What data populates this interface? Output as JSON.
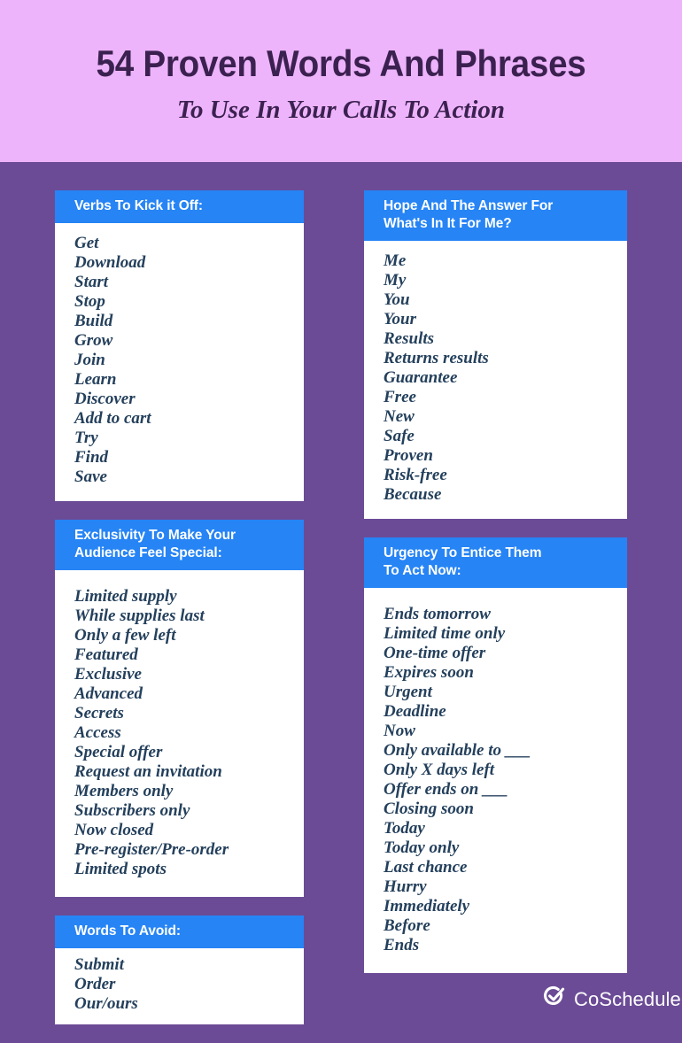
{
  "header": {
    "title": "54 Proven Words And Phrases",
    "subtitle": "To Use In Your Calls To Action",
    "background_color": "#eeb4fb",
    "text_color": "#3b2150"
  },
  "theme": {
    "page_background": "#6b4b96",
    "card_background": "#ffffff",
    "card_header_color": "#2684f5",
    "item_text_color": "#24405c"
  },
  "columns": {
    "left": [
      {
        "title_lines": [
          "Verbs To Kick it Off:"
        ],
        "items": [
          "Get",
          "Download",
          "Start",
          "Stop",
          "Build",
          "Grow",
          "Join",
          "Learn",
          "Discover",
          "Add to cart",
          "Try",
          "Find",
          "Save"
        ]
      },
      {
        "title_lines": [
          "Exclusivity To Make Your",
          "Audience Feel Special:"
        ],
        "items": [
          "Limited supply",
          "While supplies last",
          "Only a few left",
          "Featured",
          "Exclusive",
          "Advanced",
          "Secrets",
          "Access",
          "Special offer",
          "Request an invitation",
          "Members only",
          "Subscribers only",
          "Now closed",
          "Pre-register/Pre-order",
          "Limited spots"
        ]
      },
      {
        "title_lines": [
          "Words To Avoid:"
        ],
        "items": [
          "Submit",
          "Order",
          "Our/ours"
        ]
      }
    ],
    "right": [
      {
        "title_lines": [
          "Hope And The Answer For",
          "What's In It For Me?"
        ],
        "items": [
          "Me",
          "My",
          "You",
          "Your",
          "Results",
          "Returns results",
          "Guarantee",
          "Free",
          "New",
          "Safe",
          "Proven",
          "Risk-free",
          "Because"
        ]
      },
      {
        "title_lines": [
          "Urgency To Entice Them",
          "To Act Now:"
        ],
        "items": [
          "Ends tomorrow",
          "Limited time only",
          "One-time offer",
          "Expires soon",
          "Urgent",
          "Deadline",
          "Now",
          "Only available to ___",
          "Only X days left",
          "Offer ends on ___",
          "Closing soon",
          "Today",
          "Today only",
          "Last chance",
          "Hurry",
          "Immediately",
          "Before",
          "Ends"
        ]
      }
    ]
  },
  "branding": {
    "name": "CoSchedule",
    "logo_icon": "check-circle-icon",
    "logo_color": "#ffffff"
  }
}
